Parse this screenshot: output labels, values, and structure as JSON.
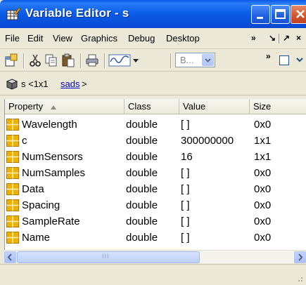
{
  "window": {
    "title": "Variable Editor - s",
    "controls": {
      "minimize": "minimize",
      "maximize": "maximize",
      "close": "close"
    }
  },
  "menu": {
    "items": [
      "File",
      "Edit",
      "View",
      "Graphics",
      "Debug",
      "Desktop"
    ],
    "overflow": "»",
    "dock_icons": [
      "↘",
      "↗",
      "×"
    ]
  },
  "toolbar": {
    "tools": [
      "new-variable-icon",
      "cut-icon",
      "copy-icon",
      "paste-icon",
      "print-icon",
      "plot-icon",
      "plot-dropdown-icon"
    ],
    "combo_value": "B...",
    "overflow": "»"
  },
  "path": {
    "prefix": "s <1x1 ",
    "link": "sads",
    "suffix": ">"
  },
  "table": {
    "columns": [
      "Property",
      "Class",
      "Value",
      "Size"
    ],
    "sort_column": "Property",
    "sort_direction": "ascending",
    "rows": [
      {
        "name": "Wavelength",
        "class": "double",
        "value": "[ ]",
        "size": "0x0"
      },
      {
        "name": "c",
        "class": "double",
        "value": "300000000",
        "size": "1x1"
      },
      {
        "name": "NumSensors",
        "class": "double",
        "value": "16",
        "size": "1x1"
      },
      {
        "name": "NumSamples",
        "class": "double",
        "value": "[ ]",
        "size": "0x0"
      },
      {
        "name": "Data",
        "class": "double",
        "value": "[ ]",
        "size": "0x0"
      },
      {
        "name": "Spacing",
        "class": "double",
        "value": "[ ]",
        "size": "0x0"
      },
      {
        "name": "SampleRate",
        "class": "double",
        "value": "[ ]",
        "size": "0x0"
      },
      {
        "name": "Name",
        "class": "double",
        "value": "[ ]",
        "size": "0x0"
      }
    ]
  },
  "scrollbar": {
    "grip": "III"
  },
  "colors": {
    "titlebar": "#0A58E8",
    "menu_bg": "#ECE9D8",
    "link": "#0000cc",
    "cell_icon": "#f0b000"
  }
}
